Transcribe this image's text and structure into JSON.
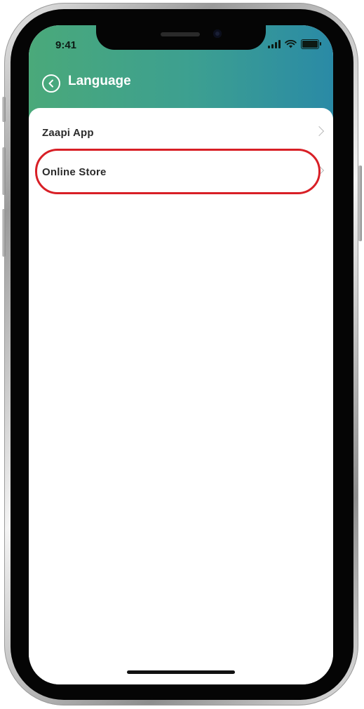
{
  "status_bar": {
    "time": "9:41"
  },
  "header": {
    "title": "Language",
    "back_icon": "chevron-left-circle-icon"
  },
  "menu": {
    "items": [
      {
        "label": "Zaapi App",
        "icon": "chevron-right-icon"
      },
      {
        "label": "Online Store",
        "icon": "chevron-right-icon",
        "highlighted": true
      }
    ]
  },
  "colors": {
    "header_gradient_start": "#4aa97a",
    "header_gradient_end": "#2a8aa6",
    "highlight": "#d81f26"
  }
}
